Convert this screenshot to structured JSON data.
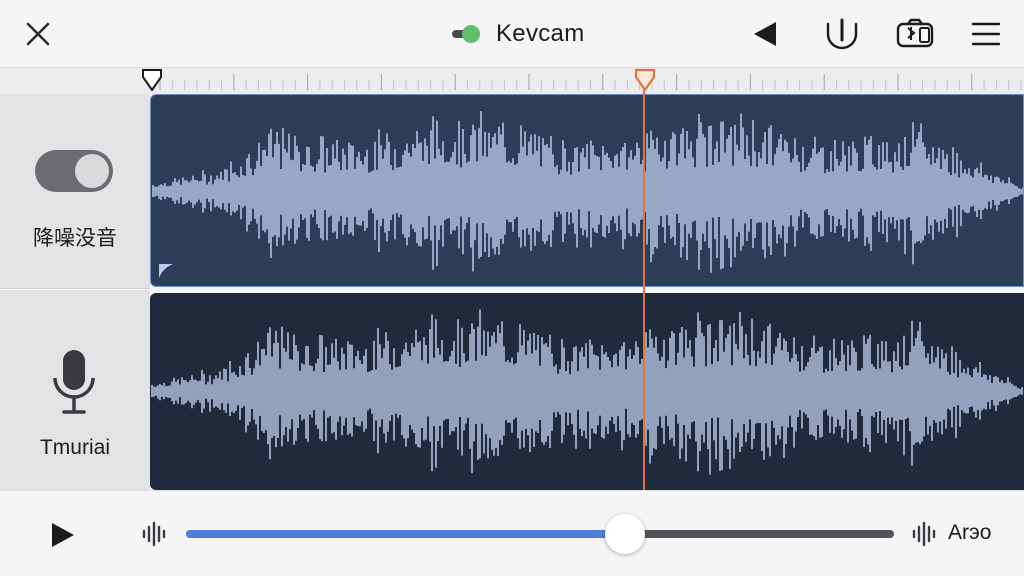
{
  "header": {
    "title": "Kevcam",
    "status_color": "#5fbf6a",
    "icons": [
      "close-icon",
      "back-triangle-icon",
      "magnet-icon",
      "camera-switch-icon",
      "menu-icon"
    ]
  },
  "tracks": [
    {
      "label": "降噪没音",
      "control": "toggle",
      "toggle_on": true,
      "color": "#2c3d57",
      "selected": true
    },
    {
      "label": "Tmuriai",
      "control": "microphone-icon",
      "color": "#1f2a3c",
      "selected": false
    }
  ],
  "playback": {
    "play_icon": "play-icon",
    "progress": 0.62,
    "end_label": "Arэo",
    "accent_color": "#4d7fd6",
    "playhead_color": "#e2733b"
  }
}
